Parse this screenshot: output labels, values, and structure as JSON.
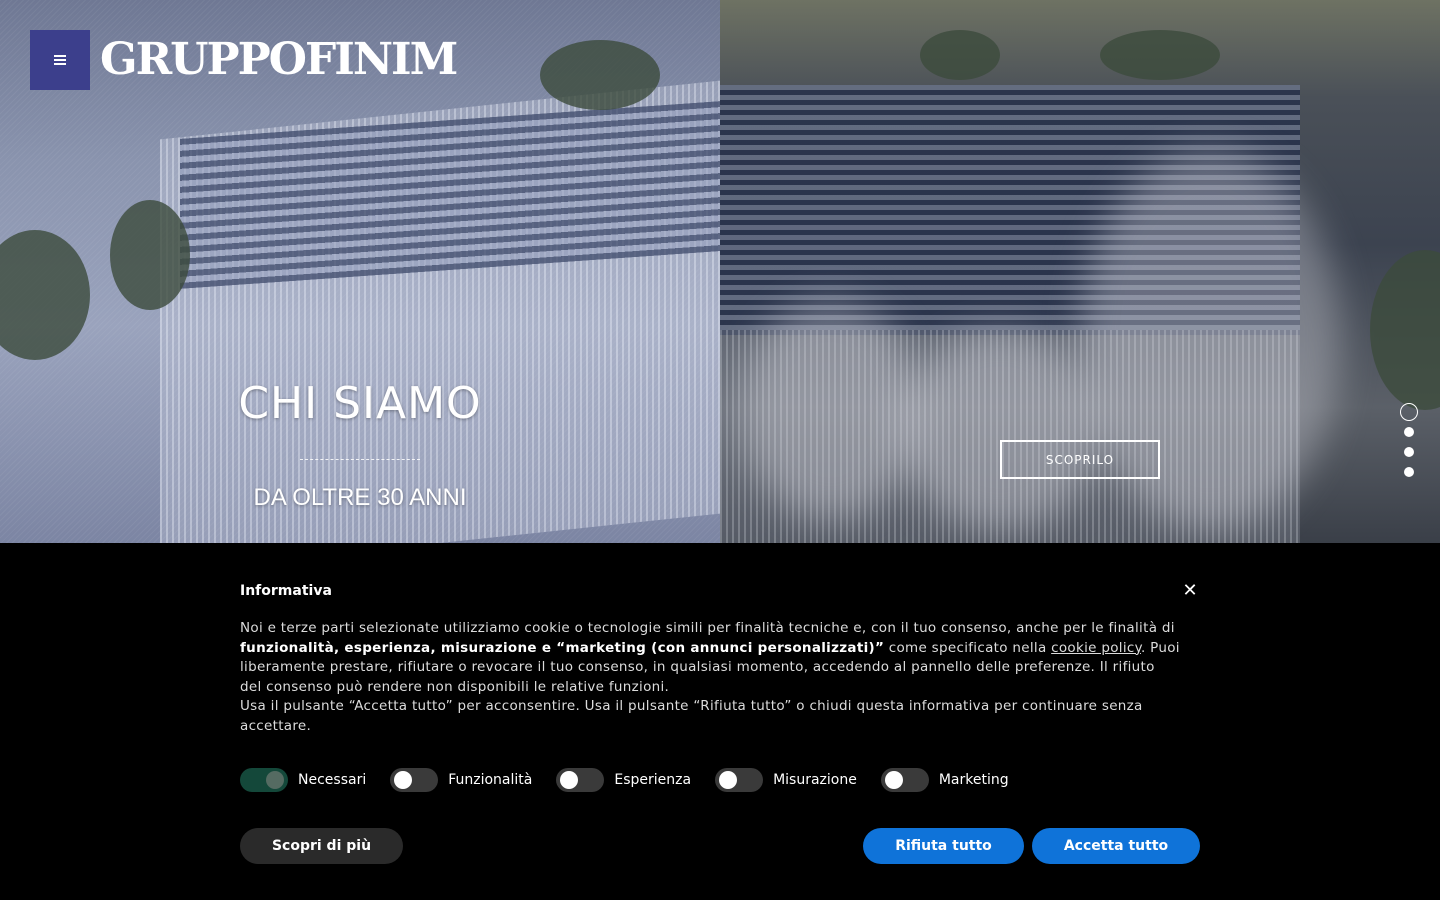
{
  "header": {
    "logo_text": "GRUPPOFINIM",
    "menu_icon": "hamburger-icon",
    "menu_color": "#3c3f8c"
  },
  "hero": {
    "title": "CHI SIAMO",
    "subtitle": "DA OLTRE 30 ANNI",
    "cta_label": "SCOPRILO",
    "slides": 4,
    "active_slide": 1
  },
  "cookie": {
    "title": "Informativa",
    "close_icon": "close-icon",
    "text_1": "Noi e terze parti selezionate utilizziamo cookie o tecnologie simili per finalità tecniche e, con il tuo consenso, anche per le finalità di",
    "text_bold": "funzionalità, esperienza, misurazione e “marketing (con annunci personalizzati)”",
    "text_2": " come specificato nella ",
    "link_label": "cookie policy",
    "text_3": ". Puoi liberamente prestare, rifiutare o revocare il tuo consenso, in qualsiasi momento, accedendo al pannello delle preferenze. Il rifiuto del consenso può rendere non disponibili le relative funzioni.",
    "text_4": "Usa il pulsante “Accetta tutto” per acconsentire. Usa il pulsante “Rifiuta tutto” o chiudi questa informativa per continuare senza accettare.",
    "toggles": [
      {
        "label": "Necessari",
        "on": true
      },
      {
        "label": "Funzionalità",
        "on": false
      },
      {
        "label": "Esperienza",
        "on": false
      },
      {
        "label": "Misurazione",
        "on": false
      },
      {
        "label": "Marketing",
        "on": false
      }
    ],
    "more_label": "Scopri di più",
    "reject_label": "Rifiuta tutto",
    "accept_label": "Accetta tutto",
    "accent_color": "#0f73d9"
  }
}
